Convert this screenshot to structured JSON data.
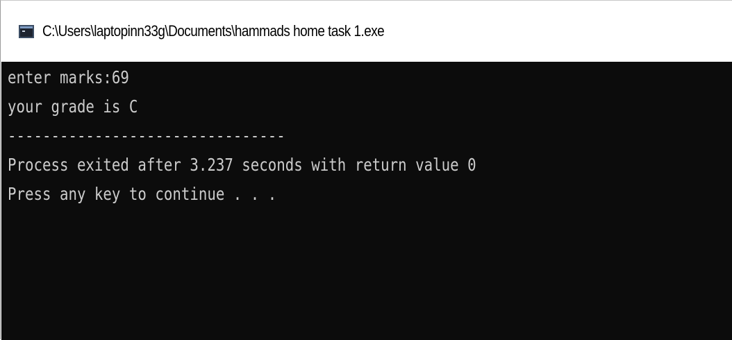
{
  "window": {
    "title": "C:\\Users\\laptopinn33g\\Documents\\hammads home task 1.exe"
  },
  "console": {
    "lines": [
      "enter marks:69",
      "your grade is C",
      "--------------------------------",
      "Process exited after 3.237 seconds with return value 0",
      "Press any key to continue . . ."
    ]
  },
  "colors": {
    "console_background": "#0c0c0c",
    "console_text": "#cccccc",
    "titlebar_background": "#ffffff"
  },
  "icons": {
    "app": "console-window-icon"
  }
}
